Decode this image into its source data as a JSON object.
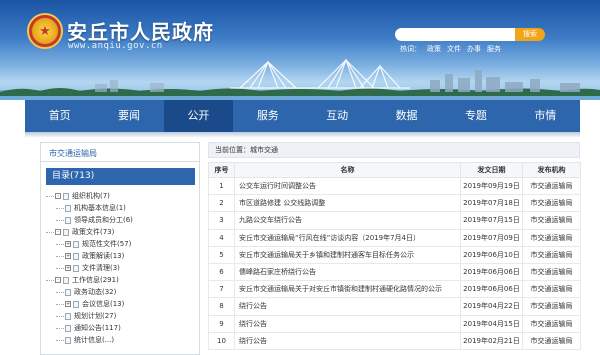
{
  "header": {
    "site_title": "安丘市人民政府",
    "site_url": "www.anqiu.gov.cn",
    "search_button": "搜索",
    "search_placeholder": "",
    "hot_label": "热词：",
    "hot_words": [
      "政策",
      "文件",
      "办事",
      "服务"
    ],
    "colors": {
      "sky": "#3d7cc6",
      "accent": "#f2a518"
    }
  },
  "nav": {
    "items": [
      "首页",
      "要闻",
      "公开",
      "服务",
      "互动",
      "数据",
      "专题",
      "市情"
    ],
    "active_index": 2,
    "color": "#2d66ad",
    "active_color": "#1a4a8a"
  },
  "sidebar": {
    "department": "市交通运输局",
    "directory_label": "目录(713)",
    "tree": [
      {
        "level": 1,
        "toggle": "-",
        "label": "组织机构(7)"
      },
      {
        "level": 2,
        "label": "机构基本信息(1)"
      },
      {
        "level": 2,
        "label": "领导成员和分工(6)"
      },
      {
        "level": 1,
        "toggle": "-",
        "label": "政策文件(73)"
      },
      {
        "level": 2,
        "toggle": "+",
        "label": "规范性文件(57)"
      },
      {
        "level": 2,
        "toggle": "+",
        "label": "政策解读(13)"
      },
      {
        "level": 2,
        "toggle": "+",
        "label": "文件清理(3)"
      },
      {
        "level": 1,
        "toggle": "-",
        "label": "工作信息(291)"
      },
      {
        "level": 2,
        "label": "政务动态(32)"
      },
      {
        "level": 2,
        "toggle": "+",
        "label": "会议信息(13)"
      },
      {
        "level": 2,
        "label": "规划计划(27)"
      },
      {
        "level": 2,
        "label": "通知公告(117)"
      },
      {
        "level": 2,
        "label": "统计信息(...)"
      }
    ]
  },
  "main": {
    "breadcrumb": "当前位置：城市交通",
    "table": {
      "headers": [
        "序号",
        "名称",
        "发文日期",
        "发布机构"
      ],
      "rows": [
        [
          "1",
          "公交车运行时间调整公告",
          "2019年09月19日",
          "市交通运输局"
        ],
        [
          "2",
          "市区道路修建 公交线路调整",
          "2019年07月18日",
          "市交通运输局"
        ],
        [
          "3",
          "九路公交车绕行公告",
          "2019年07月15日",
          "市交通运输局"
        ],
        [
          "4",
          "安丘市交通运输局“行风在线”访谈内容（2019年7月4日）",
          "2019年07月09日",
          "市交通运输局"
        ],
        [
          "5",
          "安丘市交通运输局关于乡镇和建制村通客车目标任务公示",
          "2019年06月10日",
          "市交通运输局"
        ],
        [
          "6",
          "儒峰路石家庄桥绕行公告",
          "2019年06月06日",
          "市交通运输局"
        ],
        [
          "7",
          "安丘市交通运输局关于对安丘市镇街和建制村通硬化路情况的公示",
          "2019年06月06日",
          "市交通运输局"
        ],
        [
          "8",
          "绕行公告",
          "2019年04月22日",
          "市交通运输局"
        ],
        [
          "9",
          "绕行公告",
          "2019年04月15日",
          "市交通运输局"
        ],
        [
          "10",
          "绕行公告",
          "2019年02月21日",
          "市交通运输局"
        ]
      ]
    }
  }
}
